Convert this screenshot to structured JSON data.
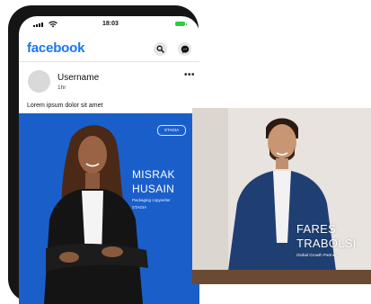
{
  "status_bar": {
    "time": "18:03"
  },
  "header": {
    "logo": "facebook",
    "icons": [
      "search-icon",
      "messenger-icon"
    ]
  },
  "post": {
    "username": "Username",
    "time": "1hr",
    "caption": "Lorem ipsum dolor sit amet",
    "more_label": "•••",
    "image": {
      "badge": "STAGIA",
      "first_name": "MISRAK",
      "last_name": "HUSAIN",
      "role": "Packaging copywriter",
      "company": "STAGIA"
    }
  },
  "overlay_photo": {
    "first_name": "FARES",
    "last_name": "TRABOLSI",
    "title": "Global Growth Partner"
  },
  "colors": {
    "brand": "#1877f2",
    "card_blue": "#1a5fc9",
    "phone_frame": "#151515",
    "battery": "#2ecc40"
  }
}
